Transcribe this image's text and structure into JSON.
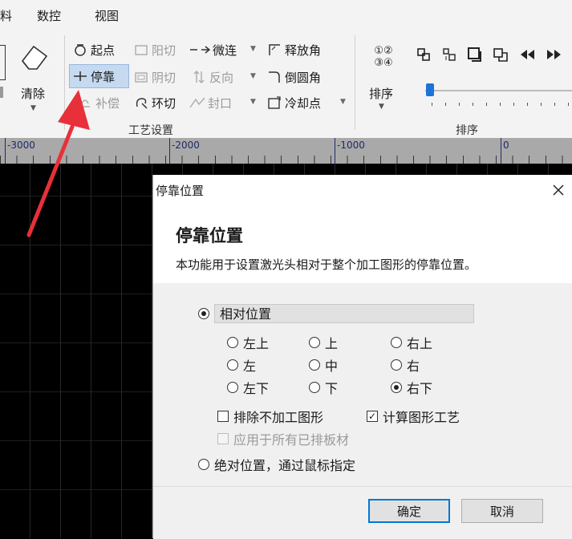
{
  "menu": {
    "items": [
      "料",
      "数控",
      "视图"
    ]
  },
  "ribbon": {
    "clear_label": "清除",
    "tools": {
      "start": "起点",
      "yangqie": "阳切",
      "micro": "微连",
      "release": "释放角",
      "park": "停靠",
      "yinqie": "阴切",
      "reverse": "反向",
      "chamfer": "倒圆角",
      "comp": "补偿",
      "loop": "环切",
      "seal": "封口",
      "cool": "冷却点"
    },
    "group_label": "工艺设置",
    "sort_label": "排序",
    "sort_group_label": "排序",
    "sort_glyph_top": "①②",
    "sort_glyph_bottom": "③④"
  },
  "ruler": {
    "labels": [
      "-3000",
      "-2000",
      "-1000",
      "0"
    ]
  },
  "dialog": {
    "title": "停靠位置",
    "heading": "停靠位置",
    "description": "本功能用于设置激光头相对于整个加工图形的停靠位置。",
    "relative_label": "相对位置",
    "positions": {
      "top_left": "左上",
      "top": "上",
      "top_right": "右上",
      "left": "左",
      "center": "中",
      "right": "右",
      "bottom_left": "左下",
      "bottom": "下",
      "bottom_right": "右下"
    },
    "exclude_label": "排除不加工图形",
    "calc_label": "计算图形工艺",
    "apply_all_label": "应用于所有已排板材",
    "absolute_label": "绝对位置，通过鼠标指定",
    "ok_label": "确定",
    "cancel_label": "取消"
  },
  "colors": {
    "arrow": "#e8303a",
    "accent": "#0078d7",
    "selected": "#c5d9f1"
  }
}
